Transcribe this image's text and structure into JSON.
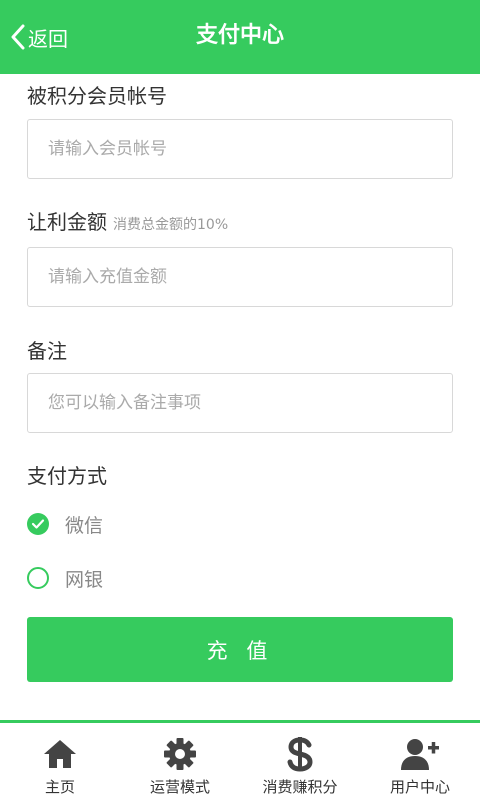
{
  "header": {
    "back_label": "返回",
    "title": "支付中心"
  },
  "form": {
    "account": {
      "label": "被积分会员帐号",
      "placeholder": "请输入会员帐号"
    },
    "profit": {
      "label": "让利金额",
      "hint": "消费总金额的10%",
      "placeholder": "请输入充值金额"
    },
    "note": {
      "label": "备注",
      "placeholder": "您可以输入备注事项"
    },
    "payment": {
      "label": "支付方式",
      "options": [
        {
          "label": "微信",
          "selected": true
        },
        {
          "label": "网银",
          "selected": false
        }
      ]
    },
    "submit_label": "充 值"
  },
  "tabbar": {
    "items": [
      {
        "label": "主页",
        "icon": "home-icon"
      },
      {
        "label": "运营模式",
        "icon": "gear-icon"
      },
      {
        "label": "消费赚积分",
        "icon": "dollar-icon"
      },
      {
        "label": "用户中心",
        "icon": "add-user-icon"
      }
    ]
  },
  "colors": {
    "accent": "#36cb5e",
    "border": "#d8d8d8",
    "placeholder": "#aaaaaa"
  }
}
